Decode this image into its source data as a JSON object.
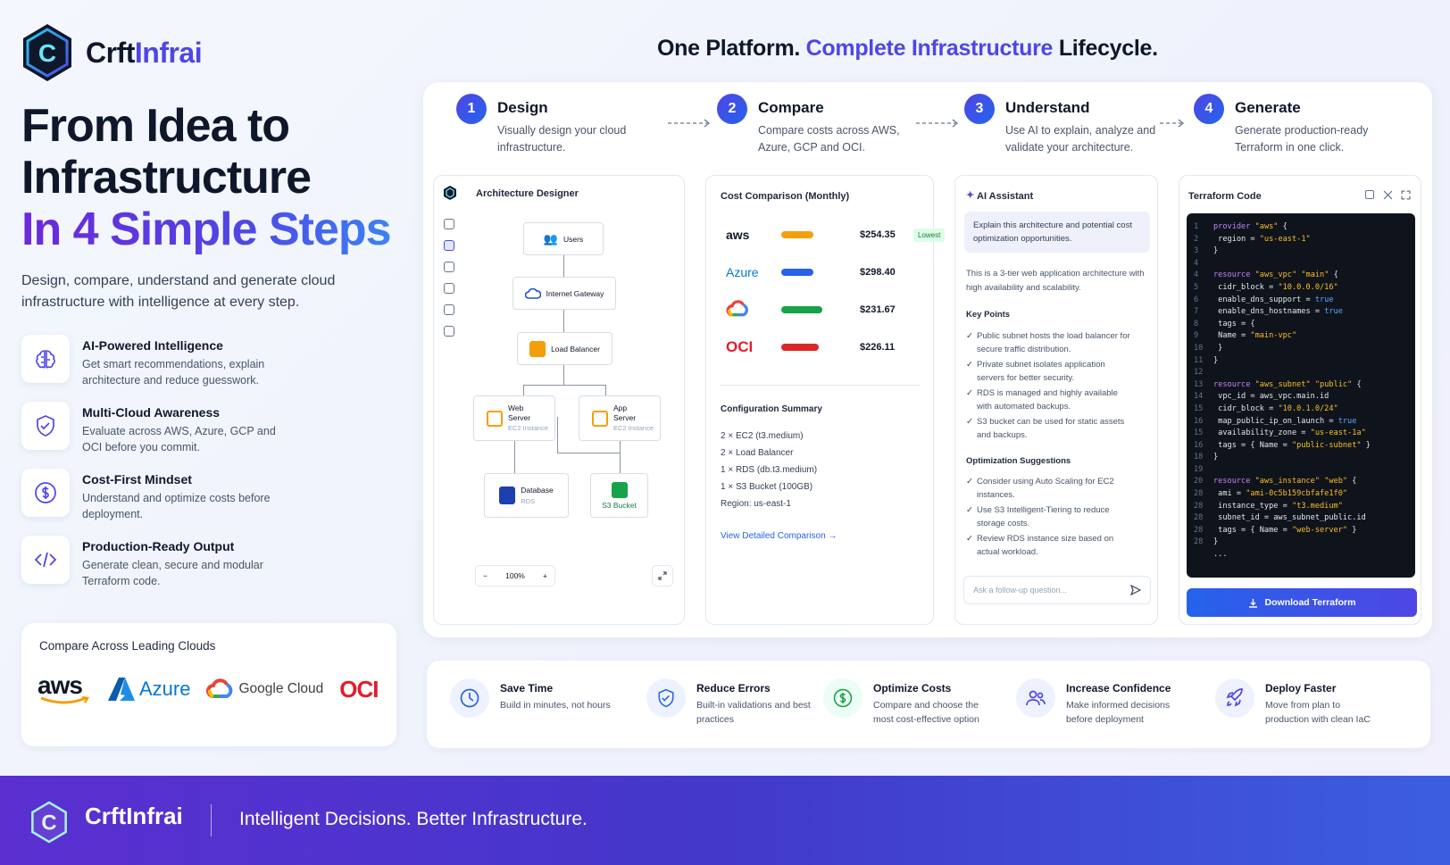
{
  "brand": {
    "name_a": "Crft",
    "name_b": "Infrai",
    "logo_letter": "C"
  },
  "hero": {
    "line1": "From Idea to",
    "line2": "Infrastructure",
    "line3": "In 4 Simple Steps"
  },
  "lead": "Design, compare, understand and generate cloud infrastructure with intelligence at every step.",
  "features": [
    {
      "title": "AI-Powered Intelligence",
      "desc": "Get smart recommendations, explain architecture and reduce guesswork.",
      "icon": "brain-icon"
    },
    {
      "title": "Multi-Cloud Awareness",
      "desc": "Evaluate across AWS, Azure, GCP and OCI before you commit.",
      "icon": "shield-check-icon"
    },
    {
      "title": "Cost-First Mindset",
      "desc": "Understand and optimize costs before deployment.",
      "icon": "dollar-icon"
    },
    {
      "title": "Production-Ready Output",
      "desc": "Generate clean, secure and modular Terraform code.",
      "icon": "code-icon"
    }
  ],
  "clouds": {
    "heading": "Compare Across Leading Clouds",
    "aws": "aws",
    "azure": "Azure",
    "google": "Google Cloud",
    "oci": "OCI"
  },
  "tagline": {
    "a": "One Platform. ",
    "b": "Complete Infrastructure",
    "c": " Lifecycle."
  },
  "steps": [
    {
      "num": "1",
      "title": "Design",
      "desc": "Visually design your cloud infrastructure."
    },
    {
      "num": "2",
      "title": "Compare",
      "desc": "Compare costs across AWS, Azure, GCP and OCI."
    },
    {
      "num": "3",
      "title": "Understand",
      "desc": "Use AI to explain, analyze and validate your architecture."
    },
    {
      "num": "4",
      "title": "Generate",
      "desc": "Generate production-ready Terraform in one click."
    }
  ],
  "designer": {
    "title": "Architecture Designer",
    "nodes": {
      "users": "Users",
      "igw": "Internet Gateway",
      "lb": "Load Balancer",
      "web_a": "Web",
      "web_b": "Server",
      "web_sub": "EC2 Instance",
      "app_a": "App",
      "app_b": "Server",
      "app_sub": "EC2 Instance",
      "db": "Database",
      "db_sub": "RDS",
      "s3": "S3 Bucket"
    },
    "zoom": "100%",
    "minus": "−",
    "plus": "+"
  },
  "cost": {
    "title": "Cost Comparison (Monthly)",
    "rows": [
      {
        "provider": "aws",
        "amount": "$254.35",
        "color": "#f59e0b",
        "badge": "Lowest"
      },
      {
        "provider": "Azure",
        "amount": "$298.40",
        "color": "#2563eb"
      },
      {
        "provider": "gcp",
        "amount": "$231.67",
        "color": "#16a34a"
      },
      {
        "provider": "OCI",
        "amount": "$226.11",
        "color": "#dc2626"
      }
    ],
    "config_title": "Configuration Summary",
    "config": [
      "2 × EC2 (t3.medium)",
      "2 × Load Balancer",
      "1 × RDS (db.t3.medium)",
      "1 × S3 Bucket (100GB)",
      "Region: us-east-1"
    ],
    "link": "View Detailed Comparison →"
  },
  "ai": {
    "title": "AI Assistant",
    "prompt": "Explain this architecture and potential cost optimization opportunities.",
    "summary": "This is a 3-tier web application architecture with high availability and scalability.",
    "kp_title": "Key Points",
    "key_points": [
      "Public subnet hosts the load balancer for secure traffic distribution.",
      "Private subnet isolates application servers for better security.",
      "RDS is managed and highly available with automated backups.",
      "S3 bucket can be used for static assets and backups."
    ],
    "opt_title": "Optimization Suggestions",
    "suggestions": [
      "Consider using Auto Scaling for EC2 instances.",
      "Use S3 Intelligent-Tiering to reduce storage costs.",
      "Review RDS instance size based on actual workload."
    ],
    "input_placeholder": "Ask a follow-up question..."
  },
  "terraform": {
    "title": "Terraform Code",
    "download": "Download Terraform",
    "lines": [
      [
        "1",
        "provider \"aws\" {"
      ],
      [
        "2",
        "  region = \"us-east-1\""
      ],
      [
        "3",
        "}"
      ],
      [
        "4",
        ""
      ],
      [
        "4",
        "resource \"aws_vpc\" \"main\" {"
      ],
      [
        "5",
        "  cidr_block          = \"10.0.0.0/16\""
      ],
      [
        "6",
        "  enable_dns_support  = true"
      ],
      [
        "7",
        "  enable_dns_hostnames = true"
      ],
      [
        "8",
        "  tags = {"
      ],
      [
        "9",
        "    Name = \"main-vpc\""
      ],
      [
        "10",
        "  }"
      ],
      [
        "11",
        "}"
      ],
      [
        "12",
        ""
      ],
      [
        "13",
        "resource \"aws_subnet\" \"public\" {"
      ],
      [
        "14",
        "  vpc_id          = aws_vpc.main.id"
      ],
      [
        "15",
        "  cidr_block      = \"10.0.1.0/24\""
      ],
      [
        "16",
        "  map_public_ip_on_launch = true"
      ],
      [
        "15",
        "  availability_zone = \"us-east-1a\""
      ],
      [
        "16",
        "  tags = { Name  = \"public-subnet\" }"
      ],
      [
        "18",
        "}"
      ],
      [
        "19",
        ""
      ],
      [
        "20",
        "resource \"aws_instance\" \"web\" {"
      ],
      [
        "28",
        "  ami             = \"ami-0c5b159cbfafe1f0\""
      ],
      [
        "28",
        "  instance_type   = \"t3.medium\""
      ],
      [
        "28",
        "  subnet_id       = aws_subnet_public.id"
      ],
      [
        "28",
        "  tags = { Name  = \"web-server\" }"
      ],
      [
        "28",
        "}"
      ],
      [
        "",
        "..."
      ]
    ]
  },
  "benefits": [
    {
      "title": "Save Time",
      "desc": "Build in minutes, not hours",
      "icon": "clock-icon"
    },
    {
      "title": "Reduce Errors",
      "desc": "Built-in validations and best practices",
      "icon": "shield-check-icon"
    },
    {
      "title": "Optimize Costs",
      "desc": "Compare and choose the most cost-effective option",
      "icon": "dollar-icon"
    },
    {
      "title": "Increase Confidence",
      "desc": "Make informed decisions before deployment",
      "icon": "users-icon"
    },
    {
      "title": "Deploy Faster",
      "desc": "Move from plan to production with clean IaC",
      "icon": "rocket-icon"
    }
  ],
  "footer": {
    "name": "CrftInfrai",
    "line": "Intelligent Decisions. Better Infrastructure."
  }
}
